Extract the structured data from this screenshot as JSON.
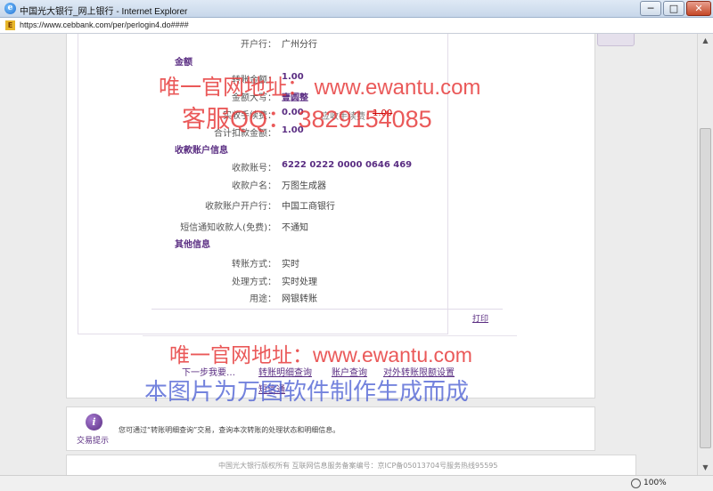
{
  "window": {
    "title": "中国光大银行_网上银行 - Internet Explorer",
    "url": "https://www.cebbank.com/per/perlogin4.do####",
    "minimize": "─",
    "maximize": "□",
    "close": "✕",
    "ie_glyph": "e",
    "site_glyph": "E"
  },
  "form": {
    "branch_label": "开户行：",
    "branch_value": "广州分行",
    "amount_section": "金额",
    "transfer_amount_label": "转账金额：",
    "transfer_amount_value": "1.00",
    "amount_upper_label": "金额大写：",
    "amount_upper_value": "壹圆整",
    "fee_label": "实收手续费：",
    "fee_value": "0.00",
    "due_fee_label": "应收手续费：",
    "due_fee_value": "1.00",
    "total_label": "合计扣款金额：",
    "total_value": "1.00",
    "payee_section": "收款账户信息",
    "payee_account_label": "收款账号：",
    "payee_account_value": "6222 0222 0000 0646 469",
    "payee_name_label": "收款户名：",
    "payee_name_value": "万图生成器",
    "payee_bank_label": "收款账户开户行：",
    "payee_bank_value": "中国工商银行",
    "sms_label": "短信通知收款人(免费)：",
    "sms_value": "不通知",
    "other_section": "其他信息",
    "transfer_mode_label": "转账方式：",
    "transfer_mode_value": "实时",
    "process_mode_label": "处理方式：",
    "process_mode_value": "实时处理",
    "purpose_label": "用途：",
    "purpose_value": "网银转账",
    "print": "打印"
  },
  "actions": {
    "next_step": "下一步我要…",
    "transfer_detail_query": "转账明细查询",
    "account_query": "账户查询",
    "external_limit_settings": "对外转账限额设置",
    "extra_link": "短信通"
  },
  "tip": {
    "icon_glyph": "i",
    "label": "交易提示",
    "text": "您可通过“转账明细查询”交易，查询本次转账的处理状态和明细信息。"
  },
  "footer": {
    "text": "中国光大银行版权所有  互联网信息服务备案编号：京ICP备05013704号服务热线95595"
  },
  "statusbar": {
    "zoom": "100%"
  },
  "watermark": {
    "line1": "唯一官网地址： www.ewantu.com",
    "line2": "客服QQ：  3829154085",
    "line3": "唯一官网地址：www.ewantu.com",
    "line4": "本图片为万图软件制作生成而成"
  },
  "colors": {
    "accent": "#5a2d82",
    "watermark_red": "#e63c3c",
    "watermark_blue": "#465ad2"
  }
}
